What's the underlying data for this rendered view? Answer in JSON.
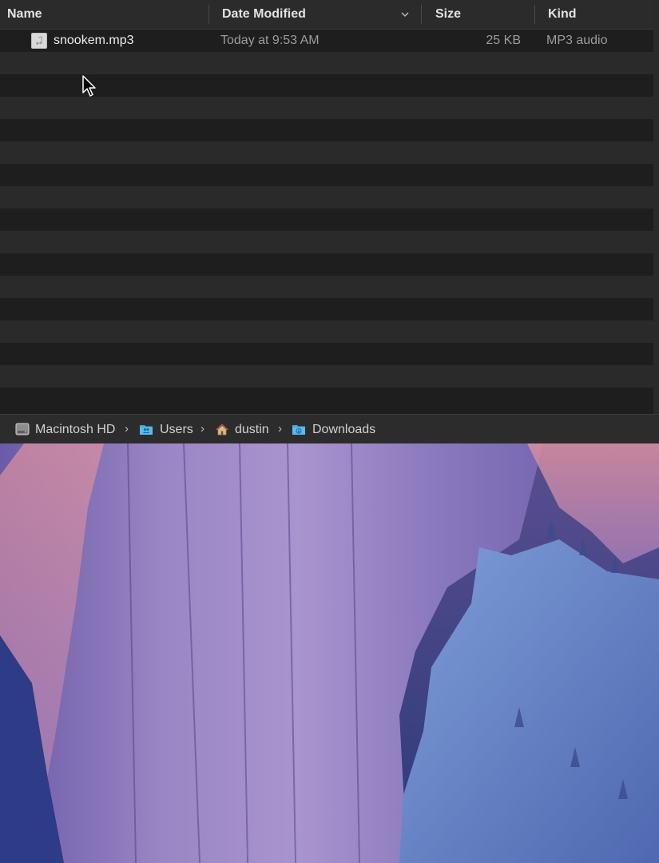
{
  "columns": {
    "name": "Name",
    "date_modified": "Date Modified",
    "size": "Size",
    "kind": "Kind"
  },
  "files": [
    {
      "name": "snookem.mp3",
      "date_modified": "Today at 9:53 AM",
      "size": "25 KB",
      "kind": "MP3 audio",
      "icon": "mp3-file-icon"
    }
  ],
  "pathbar": [
    {
      "label": "Macintosh HD",
      "icon": "hard-drive-icon"
    },
    {
      "label": "Users",
      "icon": "users-folder-icon"
    },
    {
      "label": "dustin",
      "icon": "home-icon"
    },
    {
      "label": "Downloads",
      "icon": "downloads-folder-icon"
    }
  ],
  "colors": {
    "window_bg": "#1e1e1e",
    "alt_row": "#2a2a2a",
    "header_bg": "#2b2b2b",
    "folder_blue": "#3ea7e0"
  }
}
